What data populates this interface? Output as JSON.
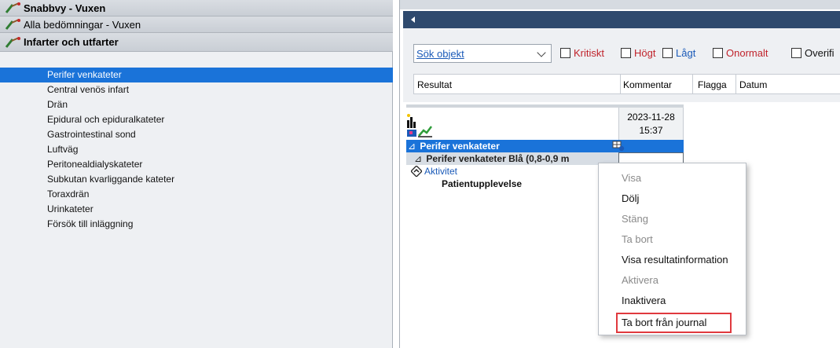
{
  "left_panel": {
    "groups": [
      {
        "label": "Snabbvy - Vuxen",
        "bold": true
      },
      {
        "label": "Alla bedömningar - Vuxen",
        "bold": false
      },
      {
        "label": "Infarter och utfarter",
        "bold": true
      }
    ],
    "items": [
      {
        "label": "Perifer venkateter",
        "selected": true
      },
      {
        "label": "Central venös infart"
      },
      {
        "label": "Drän"
      },
      {
        "label": "Epidural och epiduralkateter"
      },
      {
        "label": "Gastrointestinal sond"
      },
      {
        "label": "Luftväg"
      },
      {
        "label": "Peritonealdialyskateter"
      },
      {
        "label": "Subkutan kvarliggande kateter"
      },
      {
        "label": "Toraxdrän"
      },
      {
        "label": "Urinkateter"
      },
      {
        "label": "Försök till inläggning"
      }
    ]
  },
  "toolbar": {
    "search_select_value": "Sök objekt",
    "filters": [
      {
        "label": "Kritiskt",
        "color": "#c0232b",
        "checked": false
      },
      {
        "label": "Högt",
        "color": "#c0232b",
        "checked": false
      },
      {
        "label": "Lågt",
        "color": "#1a5ab8",
        "checked": false
      },
      {
        "label": "Onormalt",
        "color": "#c0232b",
        "checked": false
      },
      {
        "label": "Overifi",
        "color": "#111111",
        "checked": false
      }
    ]
  },
  "result_table": {
    "columns": [
      "Resultat",
      "Kommentar",
      "Flagga",
      "Datum"
    ]
  },
  "grid": {
    "date": "2023-11-28",
    "time": "15:37",
    "rows": [
      {
        "caret": "⊿",
        "label": "Perifer venkateter"
      },
      {
        "caret": "⊿",
        "label": "Perifer venkateter Blå (0,8-0,9 m"
      },
      {
        "label": "Aktivitet"
      },
      {
        "label": "Patientupplevelse"
      }
    ]
  },
  "context_menu": {
    "items": [
      {
        "label": "Visa",
        "enabled": false
      },
      {
        "label": "Dölj",
        "enabled": true
      },
      {
        "label": "Stäng",
        "enabled": false
      },
      {
        "label": "Ta bort",
        "enabled": false
      },
      {
        "label": "Visa resultatinformation",
        "enabled": true
      },
      {
        "label": "Aktivera",
        "enabled": false
      },
      {
        "label": "Inaktivera",
        "enabled": true
      },
      {
        "label": "Ta bort från journal",
        "enabled": true,
        "highlighted": true
      }
    ],
    "highlight_color": "#e0393e"
  },
  "colors": {
    "selection_blue": "#1a73d9",
    "header_dark": "#2f4a6e"
  }
}
